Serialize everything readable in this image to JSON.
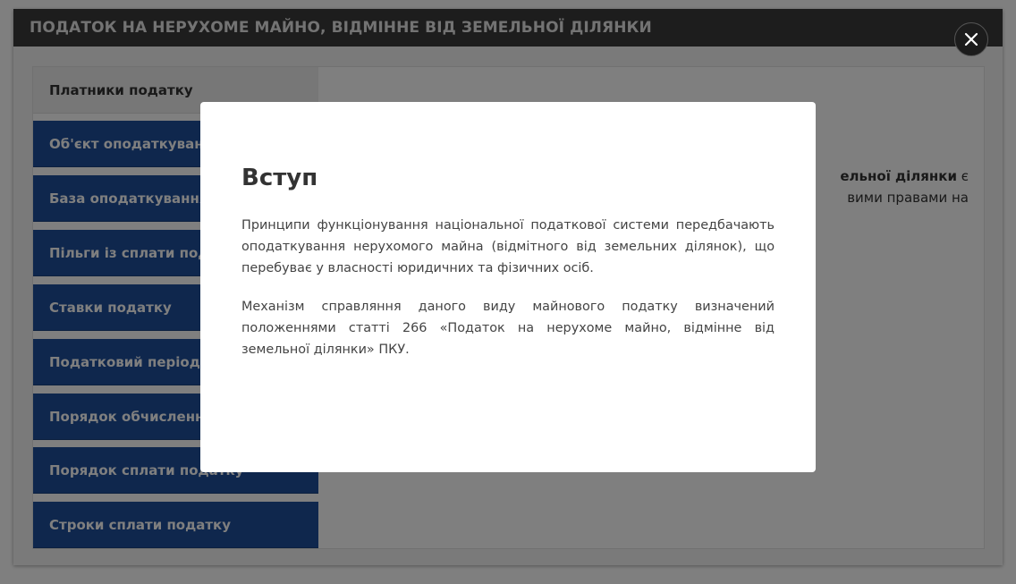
{
  "window": {
    "title": "ПОДАТОК НА НЕРУХОМЕ МАЙНО, ВІДМІННЕ ВІД ЗЕМЕЛЬНОЇ ДІЛЯНКИ"
  },
  "nav": {
    "items": [
      {
        "label": "Платники податку",
        "active": true
      },
      {
        "label": "Об'єкт оподаткування",
        "active": false
      },
      {
        "label": "База оподаткування",
        "active": false
      },
      {
        "label": "Пільги із сплати податку",
        "active": false
      },
      {
        "label": "Ставки податку",
        "active": false
      },
      {
        "label": "Податковий період",
        "active": false
      },
      {
        "label": "Порядок обчислення податку",
        "active": false
      },
      {
        "label": "Порядок сплати податку",
        "active": false
      },
      {
        "label": "Строки сплати податку",
        "active": false
      }
    ]
  },
  "content": {
    "line1_bold": "ельної ділянки",
    "line1_rest": " є",
    "line2": "вими правами на"
  },
  "modal": {
    "title": "Вступ",
    "paragraphs": [
      "Принципи функціонування національної податкової системи передбачають оподаткування нерухомого майна (відмітного від земельних ділянок), що перебуває у власності юридичних та фізичних осіб.",
      "Механізм справляння даного виду майнового податку визначений положеннями статті 266 «Податок на нерухоме майно, відмінне від земельної ділянки» ПКУ."
    ]
  },
  "close_icon": "close-icon",
  "colors": {
    "titlebar": "#3a3a3a",
    "nav_item": "#1f4f9a",
    "nav_item_active": "#eeeeee",
    "overlay": "rgba(0,0,0,0.5)"
  }
}
